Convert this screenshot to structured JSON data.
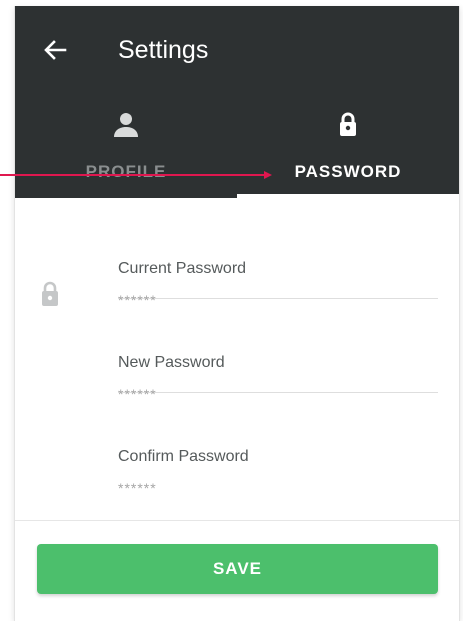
{
  "header": {
    "back_icon": "arrow-left-icon",
    "title": "Settings"
  },
  "tabs": [
    {
      "label": "PROFILE",
      "icon": "person-icon",
      "selected": false
    },
    {
      "label": "PASSWORD",
      "icon": "lock-icon",
      "selected": true
    }
  ],
  "form": {
    "side_icon": "lock-icon",
    "fields": [
      {
        "label": "Current Password",
        "value": "******"
      },
      {
        "label": "New Password",
        "value": "******"
      },
      {
        "label": "Confirm Password",
        "value": "******"
      }
    ]
  },
  "save_label": "SAVE",
  "colors": {
    "appbar": "#2d3132",
    "accent_save": "#4cbf6c",
    "annotation_arrow": "#e0174f",
    "inactive_tab": "#8a8e8f"
  }
}
